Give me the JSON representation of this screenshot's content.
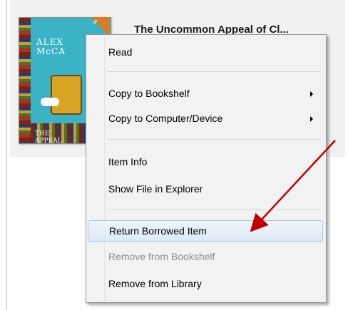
{
  "book": {
    "title": "The Uncommon Appeal of Cl...",
    "cover": {
      "author_text": "ALEXANDER\nMcCALL SMITH",
      "title_text": "THE\nUNCOMMON\nAPPEAL"
    },
    "ribbon_text": "3"
  },
  "context_menu": {
    "items": [
      {
        "label": "Read",
        "enabled": true,
        "submenu": false
      },
      {
        "label": "Copy to Bookshelf",
        "enabled": true,
        "submenu": true
      },
      {
        "label": "Copy to Computer/Device",
        "enabled": true,
        "submenu": true
      },
      {
        "label": "Item Info",
        "enabled": true,
        "submenu": false
      },
      {
        "label": "Show File in Explorer",
        "enabled": true,
        "submenu": false
      },
      {
        "label": "Return Borrowed Item",
        "enabled": true,
        "submenu": false,
        "highlighted": true
      },
      {
        "label": "Remove from Bookshelf",
        "enabled": false,
        "submenu": false
      },
      {
        "label": "Remove from Library",
        "enabled": true,
        "submenu": false
      }
    ]
  },
  "colors": {
    "cover": "#39b3c5",
    "ribbon": "#d77d27",
    "highlight": "#dde9f5",
    "annotation_arrow": "#c00000"
  },
  "annotation": {
    "type": "arrow",
    "points_to": "Return Borrowed Item"
  }
}
